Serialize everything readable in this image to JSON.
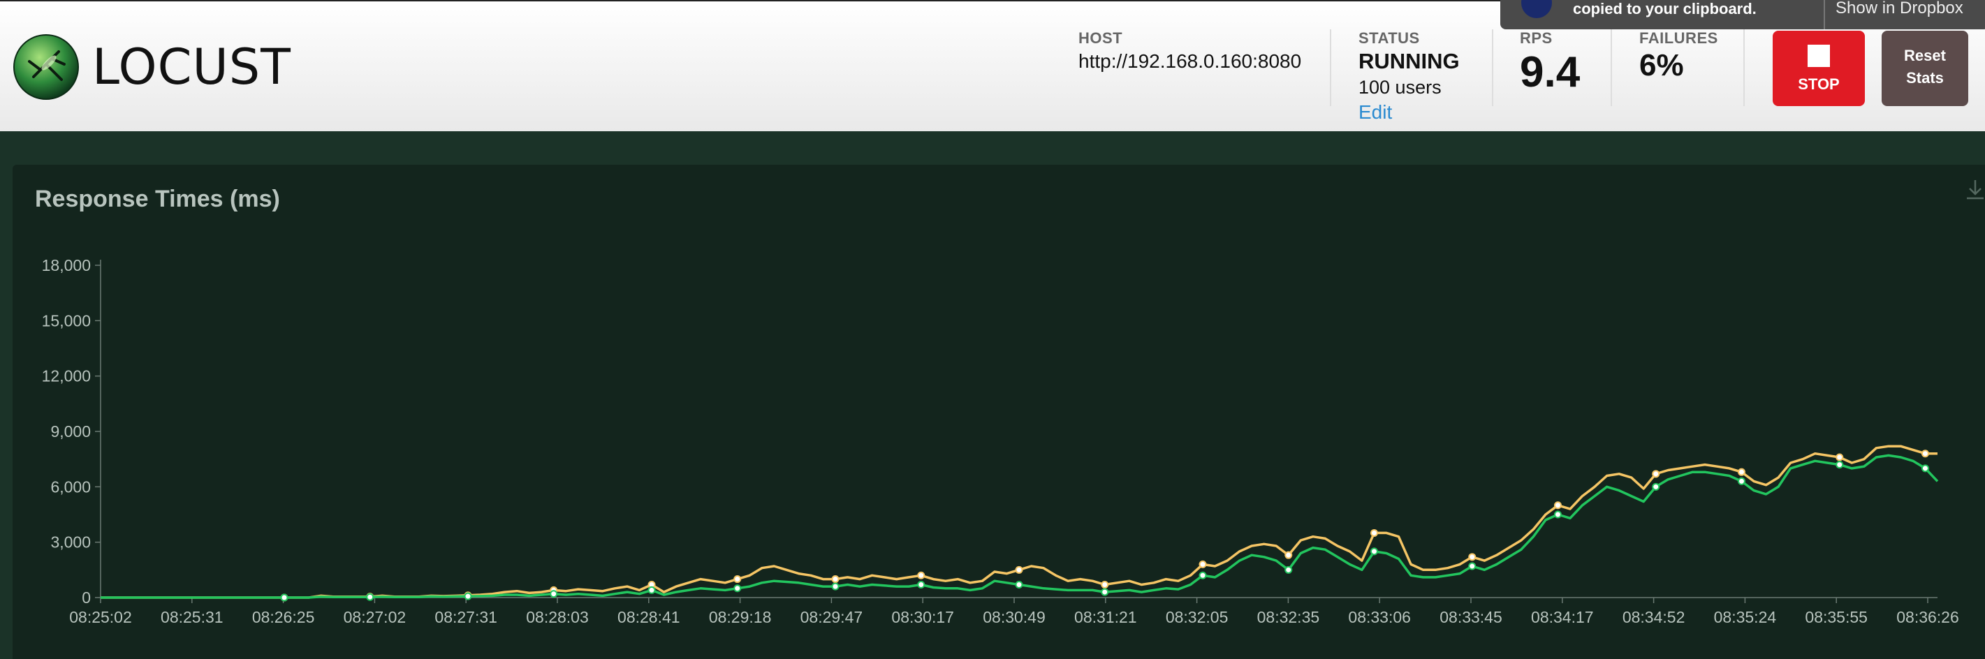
{
  "brand": {
    "name": "LOCUST"
  },
  "header": {
    "host": {
      "label": "HOST",
      "value": "http://192.168.0.160:8080"
    },
    "status": {
      "label": "STATUS",
      "value": "RUNNING",
      "users": "100 users",
      "edit": "Edit"
    },
    "rps": {
      "label": "RPS",
      "value": "9.4"
    },
    "failures": {
      "label": "FAILURES",
      "value": "6%"
    },
    "stop_label": "STOP",
    "reset_label_1": "Reset",
    "reset_label_2": "Stats"
  },
  "toast": {
    "text": "copied to your clipboard.",
    "link": "Show in Dropbox"
  },
  "colors": {
    "line_upper": "#f5c565",
    "line_lower": "#22c55e",
    "stop": "#e01b24",
    "panel": "#13251d"
  },
  "icons": [
    "locust-logo-icon",
    "stop-icon",
    "download-icon",
    "dropbox-icon"
  ],
  "chart_data": {
    "type": "line",
    "title": "Response Times (ms)",
    "ylim": [
      0,
      18000
    ],
    "yticks": [
      "0",
      "3,000",
      "6,000",
      "9,000",
      "12,000",
      "15,000",
      "18,000"
    ],
    "ytick_values": [
      0,
      3000,
      6000,
      9000,
      12000,
      15000,
      18000
    ],
    "xticks": [
      "08:25:02",
      "08:25:31",
      "08:26:25",
      "08:27:02",
      "08:27:31",
      "08:28:03",
      "08:28:41",
      "08:29:18",
      "08:29:47",
      "08:30:17",
      "08:30:49",
      "08:31:21",
      "08:32:05",
      "08:32:35",
      "08:33:06",
      "08:33:45",
      "08:34:17",
      "08:34:52",
      "08:35:24",
      "08:35:55",
      "08:36:26"
    ],
    "series": [
      {
        "values": [
          0,
          0,
          0,
          0,
          0,
          0,
          0,
          0,
          0,
          0,
          0,
          0,
          0,
          0,
          0,
          0,
          0,
          0,
          100,
          50,
          50,
          50,
          50,
          100,
          50,
          50,
          50,
          100,
          80,
          100,
          120,
          150,
          200,
          300,
          350,
          250,
          300,
          400,
          350,
          450,
          400,
          350,
          500,
          600,
          400,
          700,
          300,
          600,
          800,
          1000,
          900,
          800,
          1000,
          1200,
          1600,
          1700,
          1500,
          1300,
          1200,
          1000,
          1000,
          1100,
          1000,
          1200,
          1100,
          1000,
          1100,
          1200,
          1000,
          900,
          1000,
          800,
          900,
          1400,
          1300,
          1500,
          1700,
          1600,
          1200,
          900,
          1000,
          900,
          700,
          800,
          900,
          700,
          800,
          1000,
          900,
          1200,
          1800,
          1700,
          2000,
          2500,
          2800,
          2900,
          2800,
          2300,
          3100,
          3300,
          3200,
          2800,
          2500,
          2000,
          3500,
          3500,
          3300,
          1800,
          1500,
          1500,
          1600,
          1800,
          2200,
          2000,
          2300,
          2700,
          3100,
          3700,
          4500,
          5000,
          4800,
          5500,
          6000,
          6600,
          6700,
          6500,
          5900,
          6700,
          6900,
          7000,
          7100,
          7200,
          7100,
          7000,
          6800,
          6300,
          6100,
          6500,
          7300,
          7500,
          7800,
          7700,
          7600,
          7300,
          7500,
          8100,
          8200,
          8200,
          8000,
          7800,
          7800
        ],
        "name": ""
      },
      {
        "values": [
          0,
          0,
          0,
          0,
          0,
          0,
          0,
          0,
          0,
          0,
          0,
          0,
          0,
          0,
          0,
          0,
          0,
          0,
          50,
          30,
          30,
          30,
          30,
          50,
          30,
          30,
          30,
          60,
          50,
          60,
          70,
          80,
          100,
          150,
          150,
          100,
          150,
          200,
          150,
          200,
          150,
          100,
          200,
          300,
          200,
          400,
          150,
          300,
          400,
          500,
          450,
          400,
          500,
          600,
          800,
          900,
          850,
          800,
          700,
          600,
          600,
          700,
          600,
          700,
          650,
          600,
          600,
          700,
          550,
          500,
          500,
          400,
          500,
          900,
          800,
          700,
          600,
          500,
          450,
          400,
          400,
          400,
          300,
          350,
          400,
          300,
          400,
          500,
          450,
          700,
          1200,
          1100,
          1500,
          2000,
          2300,
          2200,
          2000,
          1500,
          2400,
          2700,
          2600,
          2200,
          1800,
          1500,
          2500,
          2400,
          2100,
          1200,
          1100,
          1100,
          1200,
          1300,
          1700,
          1500,
          1800,
          2200,
          2600,
          3300,
          4200,
          4500,
          4300,
          5000,
          5500,
          6000,
          5800,
          5500,
          5200,
          6000,
          6400,
          6600,
          6800,
          6800,
          6700,
          6600,
          6300,
          5800,
          5600,
          6000,
          7000,
          7200,
          7400,
          7300,
          7200,
          7000,
          7100,
          7600,
          7700,
          7600,
          7400,
          7000,
          6300
        ],
        "name": ""
      }
    ]
  }
}
